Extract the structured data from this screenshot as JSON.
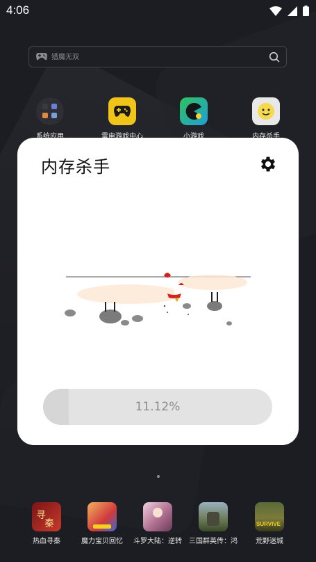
{
  "status_bar": {
    "time": "4:06"
  },
  "search": {
    "placeholder": "猎魔无双"
  },
  "top_apps": [
    {
      "label": "系统应用",
      "icon": "system-apps-folder"
    },
    {
      "label": "雷电游戏中心",
      "icon": "gamepad-icon",
      "color": "#f0c419"
    },
    {
      "label": "小游戏",
      "icon": "pacman-icon",
      "color": "#2fc25b"
    },
    {
      "label": "内存杀手",
      "icon": "smiley-icon",
      "color": "#f5d94e"
    }
  ],
  "dialog": {
    "title": "内存杀手",
    "progress": {
      "value": 11.12,
      "text": "11.12%"
    }
  },
  "bottom_games": [
    {
      "label": "热血寻秦",
      "color": "#a3242a"
    },
    {
      "label": "魔力宝贝回忆",
      "color": "#d05a3a"
    },
    {
      "label": "斗罗大陆：逆转",
      "color": "#b77a9a"
    },
    {
      "label": "三国群英传：鸿",
      "color": "#6a7a56"
    },
    {
      "label": "荒野迷城",
      "color": "#7b7a3a"
    }
  ]
}
